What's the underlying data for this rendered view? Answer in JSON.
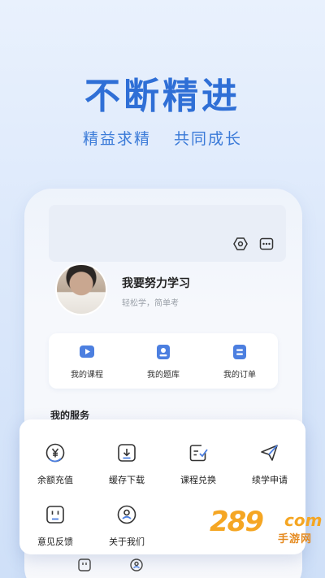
{
  "headline": "不断精进",
  "subline": {
    "left": "精益求精",
    "right": "共同成长"
  },
  "profile": {
    "name": "我要努力学习",
    "desc": "轻松学，简单考"
  },
  "quick_actions": [
    {
      "label": "我的课程",
      "icon": "play-video-icon"
    },
    {
      "label": "我的题库",
      "icon": "question-bank-icon"
    },
    {
      "label": "我的订单",
      "icon": "order-icon"
    }
  ],
  "services_title": "我的服务",
  "services": [
    {
      "label": "余额充值",
      "icon": "yen-coin-icon"
    },
    {
      "label": "缓存下载",
      "icon": "download-icon"
    },
    {
      "label": "课程兑换",
      "icon": "exchange-icon"
    },
    {
      "label": "续学申请",
      "icon": "send-icon"
    },
    {
      "label": "意见反馈",
      "icon": "feedback-icon"
    },
    {
      "label": "关于我们",
      "icon": "about-icon"
    }
  ],
  "top_icons": [
    "settings-hex-icon",
    "more-icon"
  ],
  "watermark": {
    "number": "289",
    "suffix": "com",
    "text": "手游网"
  },
  "colors": {
    "accent": "#2f6fd6",
    "quick_icon": "#4c7fe0",
    "watermark": "#f5a623"
  }
}
